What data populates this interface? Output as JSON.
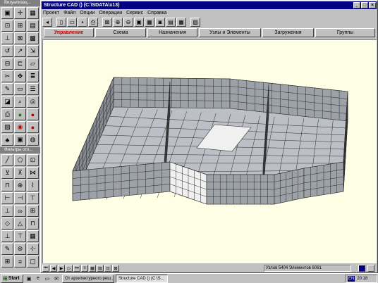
{
  "left_panel": {
    "tools_title": "Визуализац...",
    "filters_title": "Фильтры ото...",
    "tools": [
      {
        "icon": "box-icon",
        "glyph": "▣"
      },
      {
        "icon": "cross-icon",
        "glyph": "✛"
      },
      {
        "icon": "grid-icon",
        "glyph": "▦"
      },
      {
        "icon": "node-icon",
        "glyph": "⊡"
      },
      {
        "icon": "frame-icon",
        "glyph": "⊞"
      },
      {
        "icon": "plate-icon",
        "glyph": "▤"
      },
      {
        "icon": "axes-icon",
        "glyph": "⊥"
      },
      {
        "icon": "mesh-icon",
        "glyph": "⊠"
      },
      {
        "icon": "solid-icon",
        "glyph": "▩"
      },
      {
        "icon": "rotate-icon",
        "glyph": "↺"
      },
      {
        "icon": "arrow-icon",
        "glyph": "↗"
      },
      {
        "icon": "shift-icon",
        "glyph": "⇲"
      },
      {
        "icon": "fragment-icon",
        "glyph": "⊟"
      },
      {
        "icon": "section-icon",
        "glyph": "⊏"
      },
      {
        "icon": "plane-icon",
        "glyph": "▱"
      },
      {
        "icon": "scissors-icon",
        "glyph": "✂"
      },
      {
        "icon": "move-icon",
        "glyph": "✥"
      },
      {
        "icon": "layers-icon",
        "glyph": "≣"
      },
      {
        "icon": "pencil-icon",
        "glyph": "✎"
      },
      {
        "icon": "eraser-icon",
        "glyph": "▭"
      },
      {
        "icon": "stack-icon",
        "glyph": "☰"
      },
      {
        "icon": "fill-icon",
        "glyph": "◪"
      },
      {
        "icon": "magnify-icon",
        "glyph": "⌕"
      },
      {
        "icon": "zoom-icon",
        "glyph": "◎"
      },
      {
        "icon": "print-icon",
        "glyph": "⎙"
      },
      {
        "icon": "green-ball-icon",
        "glyph": "●"
      },
      {
        "icon": "red-ball-icon",
        "glyph": "●"
      },
      {
        "icon": "image-icon",
        "glyph": "▨"
      },
      {
        "icon": "record-icon",
        "glyph": "◉"
      },
      {
        "icon": "bomb-icon",
        "glyph": "●"
      },
      {
        "icon": "tree-icon",
        "glyph": "♣"
      },
      {
        "icon": "render-icon",
        "glyph": "▣"
      },
      {
        "icon": "sphere-icon",
        "glyph": "◍"
      }
    ],
    "filters": [
      {
        "icon": "line-icon",
        "glyph": "╱"
      },
      {
        "icon": "polygon-icon",
        "glyph": "⬠"
      },
      {
        "icon": "node-filter-icon",
        "glyph": "⊡"
      },
      {
        "icon": "bar-filter-icon",
        "glyph": "⊻"
      },
      {
        "icon": "shell-filter-icon",
        "glyph": "⊼"
      },
      {
        "icon": "hinge-icon",
        "glyph": "⋈"
      },
      {
        "icon": "support-icon",
        "glyph": "⊓"
      },
      {
        "icon": "joint-icon",
        "glyph": "⊕"
      },
      {
        "icon": "spring-icon",
        "glyph": "⌇"
      },
      {
        "icon": "type-a-icon",
        "glyph": "⊢"
      },
      {
        "icon": "type-b-icon",
        "glyph": "⊣"
      },
      {
        "icon": "type-c-icon",
        "glyph": "⊤"
      },
      {
        "icon": "rigid-icon",
        "glyph": "⊥"
      },
      {
        "icon": "link-icon",
        "glyph": "∞"
      },
      {
        "icon": "grid-filter-icon",
        "glyph": "⊞"
      },
      {
        "icon": "quad-icon",
        "glyph": "◇"
      },
      {
        "icon": "tri-icon",
        "glyph": "△"
      },
      {
        "icon": "bound-icon",
        "glyph": "⊓"
      },
      {
        "icon": "pin-icon",
        "glyph": "⊥"
      },
      {
        "icon": "fix-icon",
        "glyph": "⊤"
      },
      {
        "icon": "table-icon",
        "glyph": "▦"
      },
      {
        "icon": "pen-icon",
        "glyph": "✎"
      },
      {
        "icon": "stamp-icon",
        "glyph": "⊚"
      },
      {
        "icon": "axes-filter-icon",
        "glyph": "⊹"
      },
      {
        "icon": "mesh-filter-icon",
        "glyph": "⊞"
      },
      {
        "icon": "list-icon",
        "glyph": "≡"
      },
      {
        "icon": "box-filter-icon",
        "glyph": "▢"
      }
    ]
  },
  "window": {
    "title": "Structure CAD () (C:\\SDATA\\x13)",
    "buttons": {
      "minimize": "_",
      "maximize": "□",
      "close": "×"
    }
  },
  "menu": [
    "Проект",
    "Файл",
    "Опции",
    "Операции",
    "Сервис",
    "Справка"
  ],
  "toolbar": [
    {
      "icon": "arrow-back-icon",
      "glyph": "◂"
    },
    {
      "icon": "new-file-icon",
      "glyph": "▯"
    },
    {
      "icon": "open-folder-icon",
      "glyph": "▭"
    },
    {
      "icon": "save-icon",
      "glyph": "▪"
    },
    {
      "icon": "print-icon",
      "glyph": "⎙"
    },
    {
      "icon": "model-view-icon",
      "glyph": "⊠"
    },
    {
      "icon": "zoom-in-icon",
      "glyph": "⊕"
    },
    {
      "icon": "zoom-out-icon",
      "glyph": "⊖"
    },
    {
      "icon": "fit-icon",
      "glyph": "▣"
    },
    {
      "icon": "fragment-icon",
      "glyph": "▦"
    },
    {
      "icon": "camera-icon",
      "glyph": "◙"
    },
    {
      "icon": "section-icon",
      "glyph": "▤"
    },
    {
      "icon": "grid-icon",
      "glyph": "▦"
    },
    {
      "icon": "clipboard-icon",
      "glyph": "▨"
    }
  ],
  "tabs": [
    {
      "label": "Управление",
      "active": true
    },
    {
      "label": "Схема",
      "active": false
    },
    {
      "label": "Назначения",
      "active": false
    },
    {
      "label": "Узлы и Элементы",
      "active": false
    },
    {
      "label": "Загружения",
      "active": false
    },
    {
      "label": "Группы",
      "active": false
    }
  ],
  "status": {
    "text": "Узлов 5404 Элементов 6061",
    "buttons": [
      {
        "icon": "first-icon",
        "glyph": "⏮"
      },
      {
        "icon": "prev-icon",
        "glyph": "◀"
      },
      {
        "icon": "play-icon",
        "glyph": "▶"
      },
      {
        "icon": "next-icon",
        "glyph": "▷"
      },
      {
        "icon": "last-icon",
        "glyph": "⏭"
      },
      {
        "icon": "list-icon",
        "glyph": "≡"
      },
      {
        "icon": "grid-icon",
        "glyph": "▦"
      },
      {
        "icon": "table-icon",
        "glyph": "▤"
      },
      {
        "icon": "node-icon",
        "glyph": "⊡"
      },
      {
        "icon": "element-icon",
        "glyph": "⊠"
      }
    ]
  },
  "taskbar": {
    "start": "Start",
    "quicklaunch": [
      {
        "icon": "desktop-icon",
        "glyph": "▣"
      },
      {
        "icon": "browser-icon",
        "glyph": "e"
      },
      {
        "icon": "folder-icon",
        "glyph": "▭"
      },
      {
        "icon": "mail-icon",
        "glyph": "✉"
      }
    ],
    "tasks": [
      {
        "label": "От архитектурного реш...",
        "active": false
      },
      {
        "label": "Structure CAD () (C:\\S...",
        "active": true
      }
    ],
    "lang": "EN",
    "time": "20:18"
  },
  "colors": {
    "canvas": "#ffffe6",
    "mesh_top": "#bcc0c6",
    "mesh_front": "#9da1a8",
    "mesh_side": "#868a91",
    "mesh_white": "#f0f0f0",
    "title_bar": "#000080"
  }
}
